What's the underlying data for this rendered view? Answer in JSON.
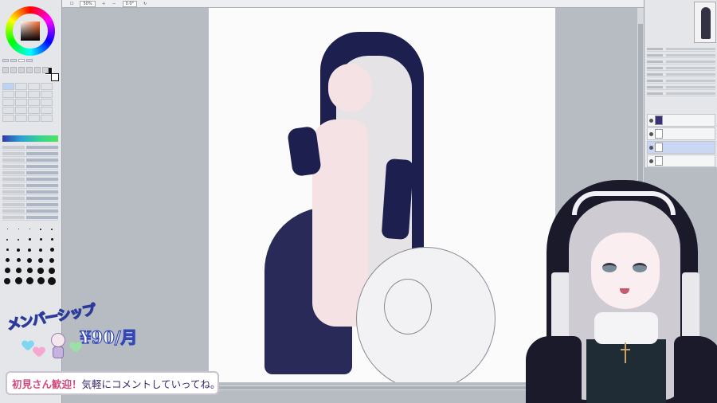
{
  "overlay": {
    "membership_title": "メンバーシップ",
    "membership_price": "¥90/月",
    "comment_highlight": "初見さん歓迎！",
    "comment_text": "気軽にコメントしていってね。"
  },
  "toolbar": {
    "zoom": "50%",
    "angle": "0.0°"
  },
  "colors": {
    "canvas_bg": "#fbfbfc",
    "workspace": "#b7bcc2",
    "panel": "#e4e6ea",
    "hood": "#1d1f4e",
    "price_stroke": "#3347b8",
    "comment_accent": "#d2497d"
  },
  "icons": {
    "color_wheel": "color-wheel-icon",
    "hearts": "heart-icon"
  }
}
